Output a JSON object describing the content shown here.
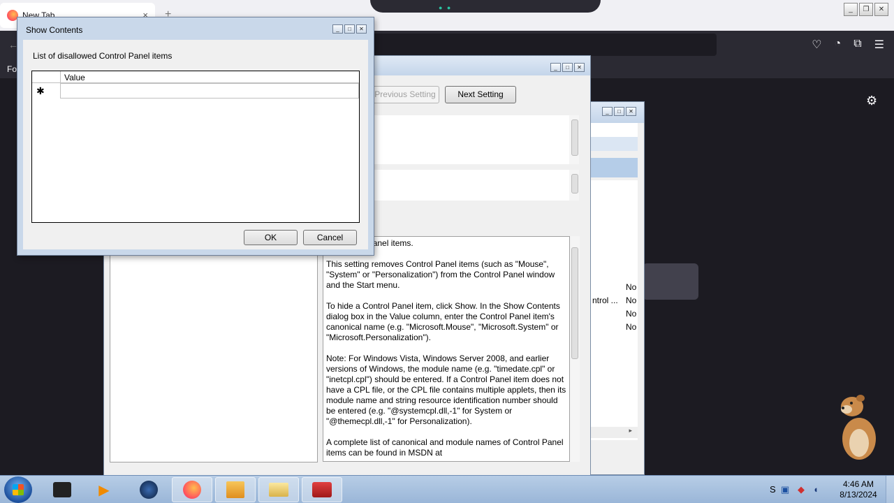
{
  "browser": {
    "tab_title": "New Tab",
    "tab_close": "×",
    "new_tab": "+",
    "bookmarks_label": "Fo"
  },
  "dialog": {
    "title": "Show Contents",
    "label": "List of disallowed Control Panel items",
    "column_header": "Value",
    "new_row_marker": "✱",
    "ok": "OK",
    "cancel": "Cancel"
  },
  "policy": {
    "previous_setting": "Previous Setting",
    "next_setting": "Next Setting",
    "help_first_line": "ed Control Panel items.",
    "help_paragraphs": [
      "This setting removes Control Panel items (such as \"Mouse\",\n\"System\" or \"Personalization\") from the Control Panel window\nand the Start menu.",
      "To hide a Control Panel item, click Show. In the Show Contents\ndialog box in the Value column, enter the Control Panel item's\ncanonical name (e.g. \"Microsoft.Mouse\", \"Microsoft.System\" or\n\"Microsoft.Personalization\").",
      "Note: For Windows Vista, Windows Server 2008, and earlier\nversions of Windows, the module name (e.g. \"timedate.cpl\" or\n\"inetcpl.cpl\") should be entered. If a Control Panel item does not\nhave a CPL file, or the CPL file contains multiple applets, then its\nmodule name and string resource identification number should\nbe entered (e.g. \"@systemcpl.dll,-1\" for System or\n\"@themecpl.dll,-1\" for Personalization).",
      "A complete list of canonical and module names of Control Panel\nitems can be found in MSDN at"
    ]
  },
  "background_list": {
    "row_label": "ntrol ...",
    "states": [
      "No",
      "No",
      "No",
      "No"
    ]
  },
  "taskbar": {
    "time": "4:46 AM",
    "date": "8/13/2024",
    "tray_letter": "S"
  }
}
